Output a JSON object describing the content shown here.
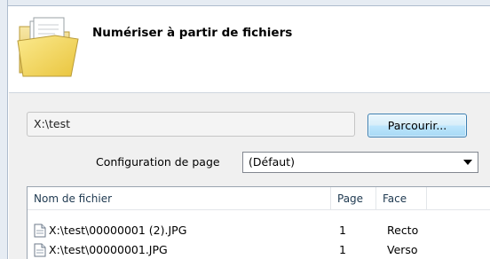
{
  "header": {
    "title": "Numériser à partir de fichiers",
    "icon": "folder-icon"
  },
  "path_field": {
    "value": "X:\\test"
  },
  "browse_button": {
    "label": "Parcourir..."
  },
  "page_config": {
    "label": "Configuration de page",
    "selected": "(Défaut)"
  },
  "file_list": {
    "columns": [
      "Nom de fichier",
      "Page",
      "Face"
    ],
    "rows": [
      {
        "name": "X:\\test\\00000001 (2).JPG",
        "page": "1",
        "face": "Recto"
      },
      {
        "name": "X:\\test\\00000001.JPG",
        "page": "1",
        "face": "Verso"
      }
    ]
  },
  "colors": {
    "button_border": "#3c7fb1",
    "frame": "#e6ecf3",
    "content_bg": "#f0f0f0"
  }
}
